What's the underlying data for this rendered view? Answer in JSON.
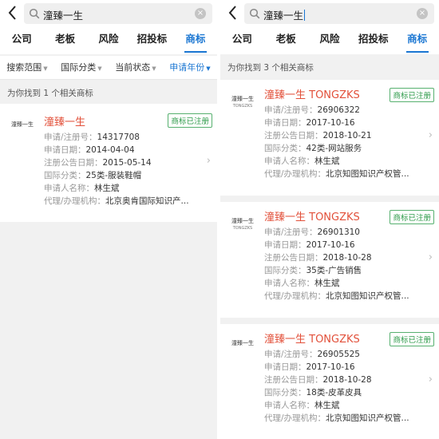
{
  "left": {
    "search": {
      "query": "潼臻一生"
    },
    "tabs": [
      {
        "label": "公司"
      },
      {
        "label": "老板"
      },
      {
        "label": "风险"
      },
      {
        "label": "招投标"
      },
      {
        "label": "商标"
      }
    ],
    "filters": [
      {
        "label": "搜索范围"
      },
      {
        "label": "国际分类"
      },
      {
        "label": "当前状态"
      },
      {
        "label": "申请年份"
      }
    ],
    "result_count": "为你找到 1 个相关商标",
    "results": [
      {
        "logo_text": "潼臻一生",
        "title": "潼臻一生",
        "status": "商标已注册",
        "fields": [
          {
            "label": "申请/注册号：",
            "value": "14317708"
          },
          {
            "label": "申请日期：",
            "value": "2014-04-04"
          },
          {
            "label": "注册公告日期：",
            "value": "2015-05-14"
          },
          {
            "label": "国际分类：",
            "value": "25类-服装鞋帽"
          },
          {
            "label": "申请人名称：",
            "value": "林生斌"
          },
          {
            "label": "代理/办理机构：",
            "value": "北京奥肯国际知识产..."
          }
        ]
      }
    ]
  },
  "right": {
    "search": {
      "query": "潼臻一生"
    },
    "tabs": [
      {
        "label": "公司"
      },
      {
        "label": "老板"
      },
      {
        "label": "风险"
      },
      {
        "label": "招投标"
      },
      {
        "label": "商标"
      }
    ],
    "result_count": "为你找到 3 个相关商标",
    "results": [
      {
        "logo_text": "潼臻一生",
        "logo_sub": "TONGZKS",
        "title": "潼臻一生 TONGZKS",
        "status": "商标已注册",
        "fields": [
          {
            "label": "申请/注册号：",
            "value": "26906322"
          },
          {
            "label": "申请日期：",
            "value": "2017-10-16"
          },
          {
            "label": "注册公告日期：",
            "value": "2018-10-21"
          },
          {
            "label": "国际分类：",
            "value": "42类-网站服务"
          },
          {
            "label": "申请人名称：",
            "value": "林生斌"
          },
          {
            "label": "代理/办理机构：",
            "value": "北京知图知识产权管..."
          }
        ]
      },
      {
        "logo_text": "潼臻一生",
        "logo_sub": "TONGZKS",
        "title": "潼臻一生 TONGZKS",
        "status": "商标已注册",
        "fields": [
          {
            "label": "申请/注册号：",
            "value": "26901310"
          },
          {
            "label": "申请日期：",
            "value": "2017-10-16"
          },
          {
            "label": "注册公告日期：",
            "value": "2018-10-28"
          },
          {
            "label": "国际分类：",
            "value": "35类-广告销售"
          },
          {
            "label": "申请人名称：",
            "value": "林生斌"
          },
          {
            "label": "代理/办理机构：",
            "value": "北京知图知识产权管..."
          }
        ]
      },
      {
        "logo_text": "潼臻一生",
        "title": "潼臻一生 TONGZKS",
        "status": "商标已注册",
        "fields": [
          {
            "label": "申请/注册号：",
            "value": "26905525"
          },
          {
            "label": "申请日期：",
            "value": "2017-10-16"
          },
          {
            "label": "注册公告日期：",
            "value": "2018-10-28"
          },
          {
            "label": "国际分类：",
            "value": "18类-皮革皮具"
          },
          {
            "label": "申请人名称：",
            "value": "林生斌"
          },
          {
            "label": "代理/办理机构：",
            "value": "北京知图知识产权管..."
          }
        ]
      }
    ]
  }
}
